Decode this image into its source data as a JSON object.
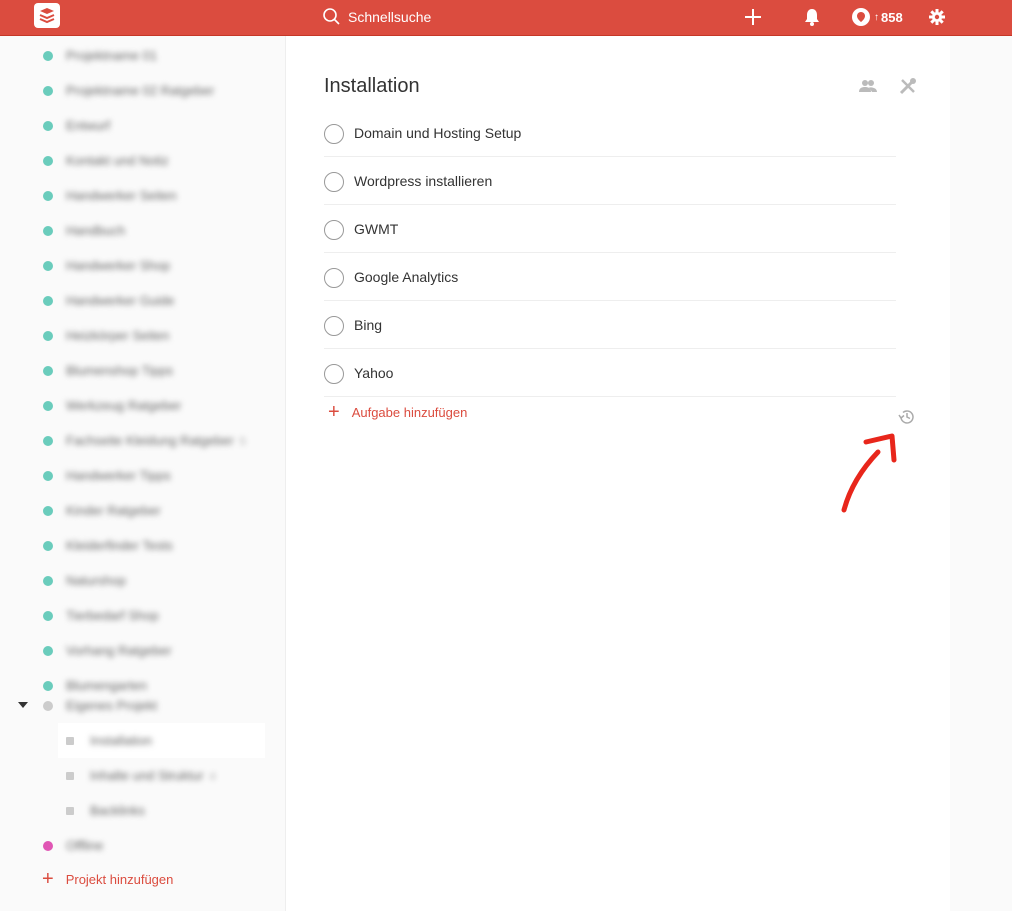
{
  "topbar": {
    "search_label": "Schnellsuche",
    "karma_value": "858",
    "karma_arrow": "↑",
    "bg_color": "#db4c3f"
  },
  "sidebar": {
    "projects": [
      {
        "name": "Projektname 01",
        "color": "#6accbc"
      },
      {
        "name": "Projektname 02 Ratgeber",
        "color": "#6accbc"
      },
      {
        "name": "Entwurf",
        "color": "#6accbc"
      },
      {
        "name": "Kontakt und Notiz",
        "color": "#6accbc"
      },
      {
        "name": "Handwerker Seiten",
        "color": "#6accbc"
      },
      {
        "name": "Handbuch",
        "color": "#6accbc"
      },
      {
        "name": "Handwerker Shop",
        "color": "#6accbc"
      },
      {
        "name": "Handwerker Guide",
        "color": "#6accbc"
      },
      {
        "name": "Heizkörper Seiten",
        "color": "#6accbc"
      },
      {
        "name": "Blumenshop Tipps",
        "color": "#6accbc"
      },
      {
        "name": "Werkzeug Ratgeber",
        "color": "#6accbc"
      },
      {
        "name": "Fachseite Kleidung Ratgeber",
        "color": "#6accbc",
        "count": "5"
      },
      {
        "name": "Handwerker Tipps",
        "color": "#6accbc"
      },
      {
        "name": "Kinder Ratgeber",
        "color": "#6accbc"
      },
      {
        "name": "Kleiderfinder Tests",
        "color": "#6accbc"
      },
      {
        "name": "Naturshop",
        "color": "#6accbc"
      },
      {
        "name": "Tierbedarf Shop",
        "color": "#6accbc"
      },
      {
        "name": "Vorhang Ratgeber",
        "color": "#6accbc"
      },
      {
        "name": "Blumengarten",
        "color": "#6accbc"
      }
    ],
    "group": {
      "name": "Eigenes Projekt",
      "color": "#cccccc"
    },
    "subprojects": [
      {
        "name": "Installation"
      },
      {
        "name": "Inhalte und Struktur",
        "count": "4"
      },
      {
        "name": "Backlinks"
      }
    ],
    "last_project": {
      "name": "Offline",
      "color": "#e056b4"
    },
    "add_project_label": "Projekt hinzufügen"
  },
  "main": {
    "title": "Installation",
    "tasks": [
      {
        "label": "Domain und Hosting Setup"
      },
      {
        "label": "Wordpress installieren"
      },
      {
        "label": "GWMT"
      },
      {
        "label": "Google Analytics"
      },
      {
        "label": "Bing"
      },
      {
        "label": "Yahoo"
      }
    ],
    "add_task_label": "Aufgabe hinzufügen"
  },
  "icons": {
    "logo": "todoist-logo-icon",
    "search": "search-icon",
    "add": "plus-icon",
    "notifications": "bell-icon",
    "karma": "karma-icon",
    "settings": "gear-icon",
    "share": "users-icon",
    "project_actions": "tools-icon",
    "history": "history-icon"
  },
  "colors": {
    "accent": "#db4c3f",
    "teal": "#6accbc"
  }
}
